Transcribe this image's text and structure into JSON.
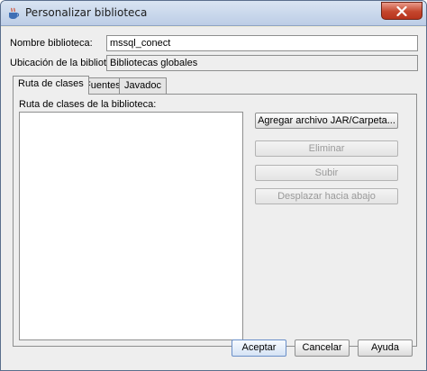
{
  "window": {
    "title": "Personalizar biblioteca"
  },
  "form": {
    "name_label": "Nombre biblioteca:",
    "name_value": "mssql_conect",
    "location_label": "Ubicación de la biblioteca",
    "location_value": "Bibliotecas globales"
  },
  "tabs": [
    {
      "label": "Ruta de clases",
      "active": true
    },
    {
      "label": "Fuentes",
      "active": false
    },
    {
      "label": "Javadoc",
      "active": false
    }
  ],
  "classpath": {
    "list_label": "Ruta de clases de la biblioteca:",
    "add_button": "Agregar archivo JAR/Carpeta...",
    "remove_button": "Eliminar",
    "up_button": "Subir",
    "down_button": "Desplazar hacia abajo"
  },
  "footer": {
    "ok_button": "Aceptar",
    "cancel_button": "Cancelar",
    "help_button": "Ayuda"
  },
  "colors": {
    "close_button": "#c4462d",
    "titlebar": "#c9d8ec",
    "dialog_background": "#eeeeee"
  }
}
